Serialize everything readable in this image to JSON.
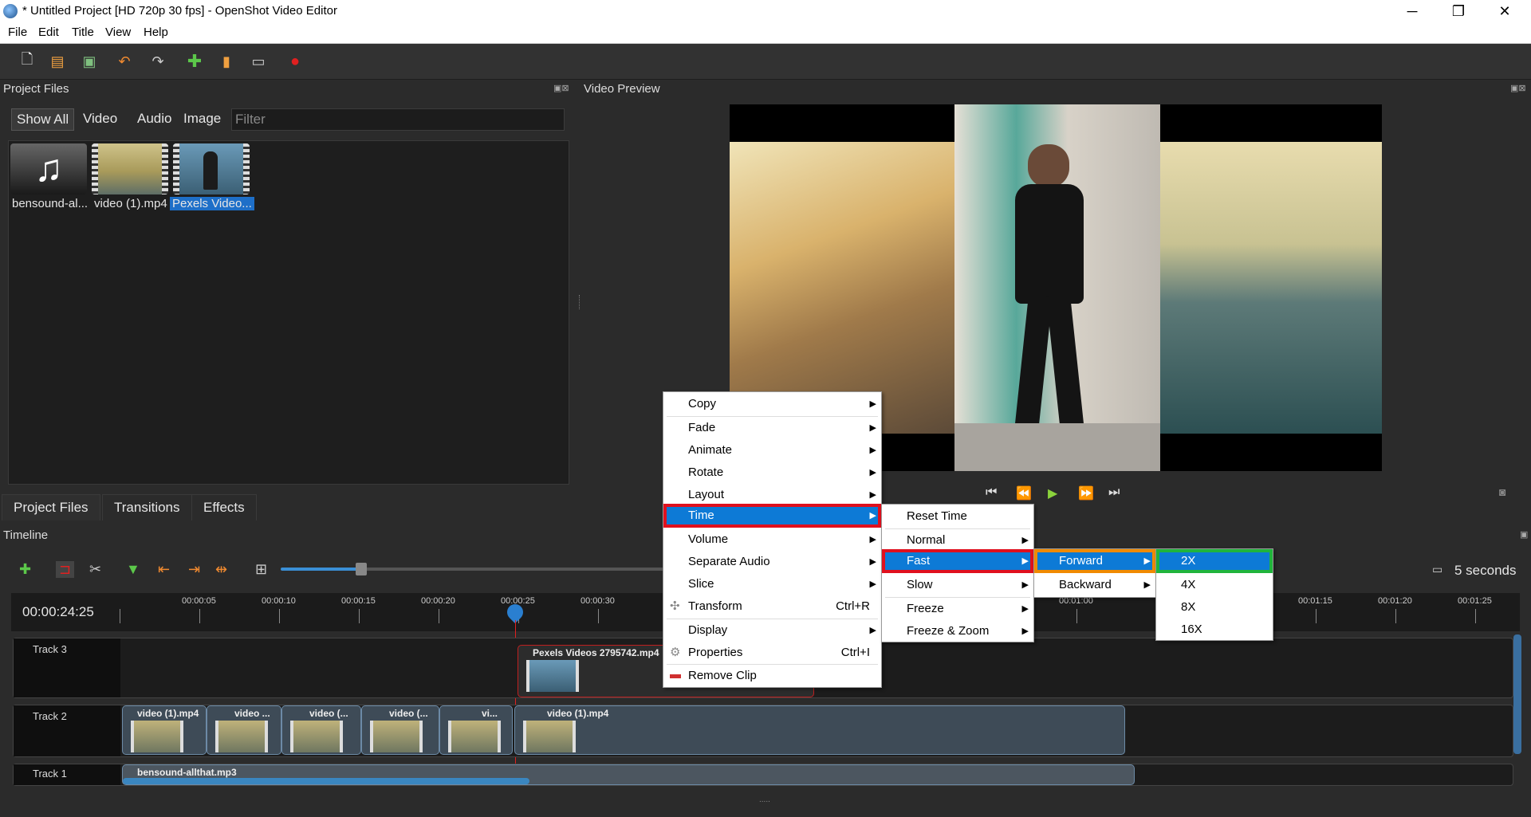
{
  "window": {
    "title": "* Untitled Project [HD 720p 30 fps] - OpenShot Video Editor",
    "min": "─",
    "max": "❐",
    "close": "✕"
  },
  "menubar": [
    "File",
    "Edit",
    "Title",
    "View",
    "Help"
  ],
  "toolbar_icons": [
    "new-project-icon",
    "open-project-icon",
    "save-project-icon",
    "undo-icon",
    "redo-icon",
    "import-files-icon",
    "choose-profile-icon",
    "fullscreen-icon",
    "export-video-icon"
  ],
  "project_files": {
    "title": "Project Files",
    "filters": [
      "Show All",
      "Video",
      "Audio",
      "Image"
    ],
    "filter_placeholder": "Filter",
    "files": [
      {
        "label": "bensound-al..."
      },
      {
        "label": "video (1).mp4"
      },
      {
        "label": "Pexels Video..."
      }
    ],
    "bottom_tabs": [
      "Project Files",
      "Transitions",
      "Effects"
    ]
  },
  "preview": {
    "title": "Video Preview"
  },
  "timeline": {
    "title": "Timeline",
    "current_time": "00:00:24:25",
    "zoom_label": "5 seconds",
    "ticks": [
      "00:00:05",
      "00:00:10",
      "00:00:15",
      "00:00:20",
      "00:00:25",
      "00:00:30",
      "00:01:00",
      "00:01:15",
      "00:01:20",
      "00:01:25"
    ],
    "tracks": [
      {
        "name": "Track 3",
        "clips": [
          {
            "label": "Pexels Videos 2795742.mp4"
          }
        ]
      },
      {
        "name": "Track 2",
        "clips": [
          {
            "label": "video (1).mp4"
          },
          {
            "label": "video ..."
          },
          {
            "label": "video (..."
          },
          {
            "label": "video (..."
          },
          {
            "label": "vi..."
          },
          {
            "label": "video (1).mp4"
          }
        ]
      },
      {
        "name": "Track 1",
        "clips": [
          {
            "label": "bensound-allthat.mp3"
          }
        ]
      }
    ]
  },
  "context_menu": {
    "items": [
      "Copy",
      "Fade",
      "Animate",
      "Rotate",
      "Layout",
      "Time",
      "Volume",
      "Separate Audio",
      "Slice",
      "Transform",
      "Display",
      "Properties",
      "Remove Clip"
    ],
    "transform_shortcut": "Ctrl+R",
    "properties_shortcut": "Ctrl+I"
  },
  "time_menu": {
    "items": [
      "Reset Time",
      "Normal",
      "Fast",
      "Slow",
      "Freeze",
      "Freeze & Zoom"
    ]
  },
  "fast_menu": {
    "items": [
      "Forward",
      "Backward"
    ]
  },
  "forward_menu": {
    "items": [
      "2X",
      "4X",
      "8X",
      "16X"
    ]
  },
  "highlight_colors": {
    "time": "#e0101e",
    "fast": "#e0101e",
    "forward": "#f08a00",
    "twox": "#20b43c"
  }
}
